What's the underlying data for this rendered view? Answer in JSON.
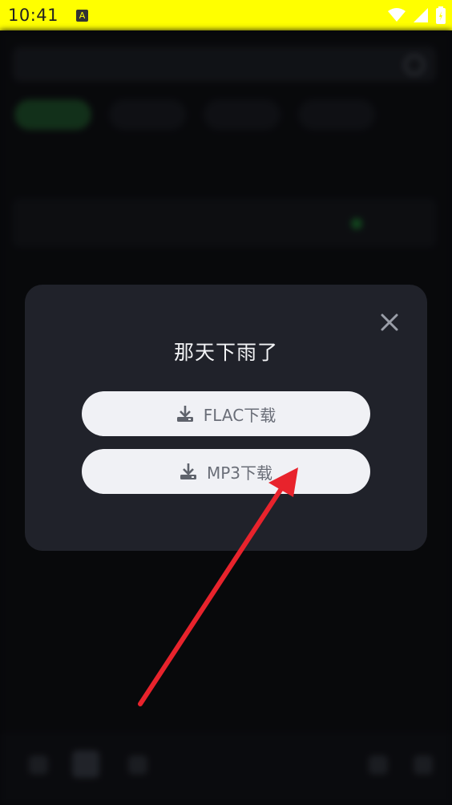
{
  "status_bar": {
    "time": "10:41",
    "notification_icon": "a-icon",
    "icons": [
      "wifi-icon",
      "signal-icon",
      "battery-icon"
    ],
    "background_color": "#ffff00"
  },
  "dialog": {
    "title": "那天下雨了",
    "close_icon": "close-icon",
    "buttons": [
      {
        "label": "FLAC下载",
        "icon": "download-icon"
      },
      {
        "label": "MP3下载",
        "icon": "download-icon"
      }
    ]
  },
  "annotation": {
    "arrow_color": "#e8232c"
  },
  "colors": {
    "dialog_bg": "#20222a",
    "button_bg": "#f0f1f5",
    "button_text": "#6a6e78",
    "title_text": "#f2f3f5"
  }
}
